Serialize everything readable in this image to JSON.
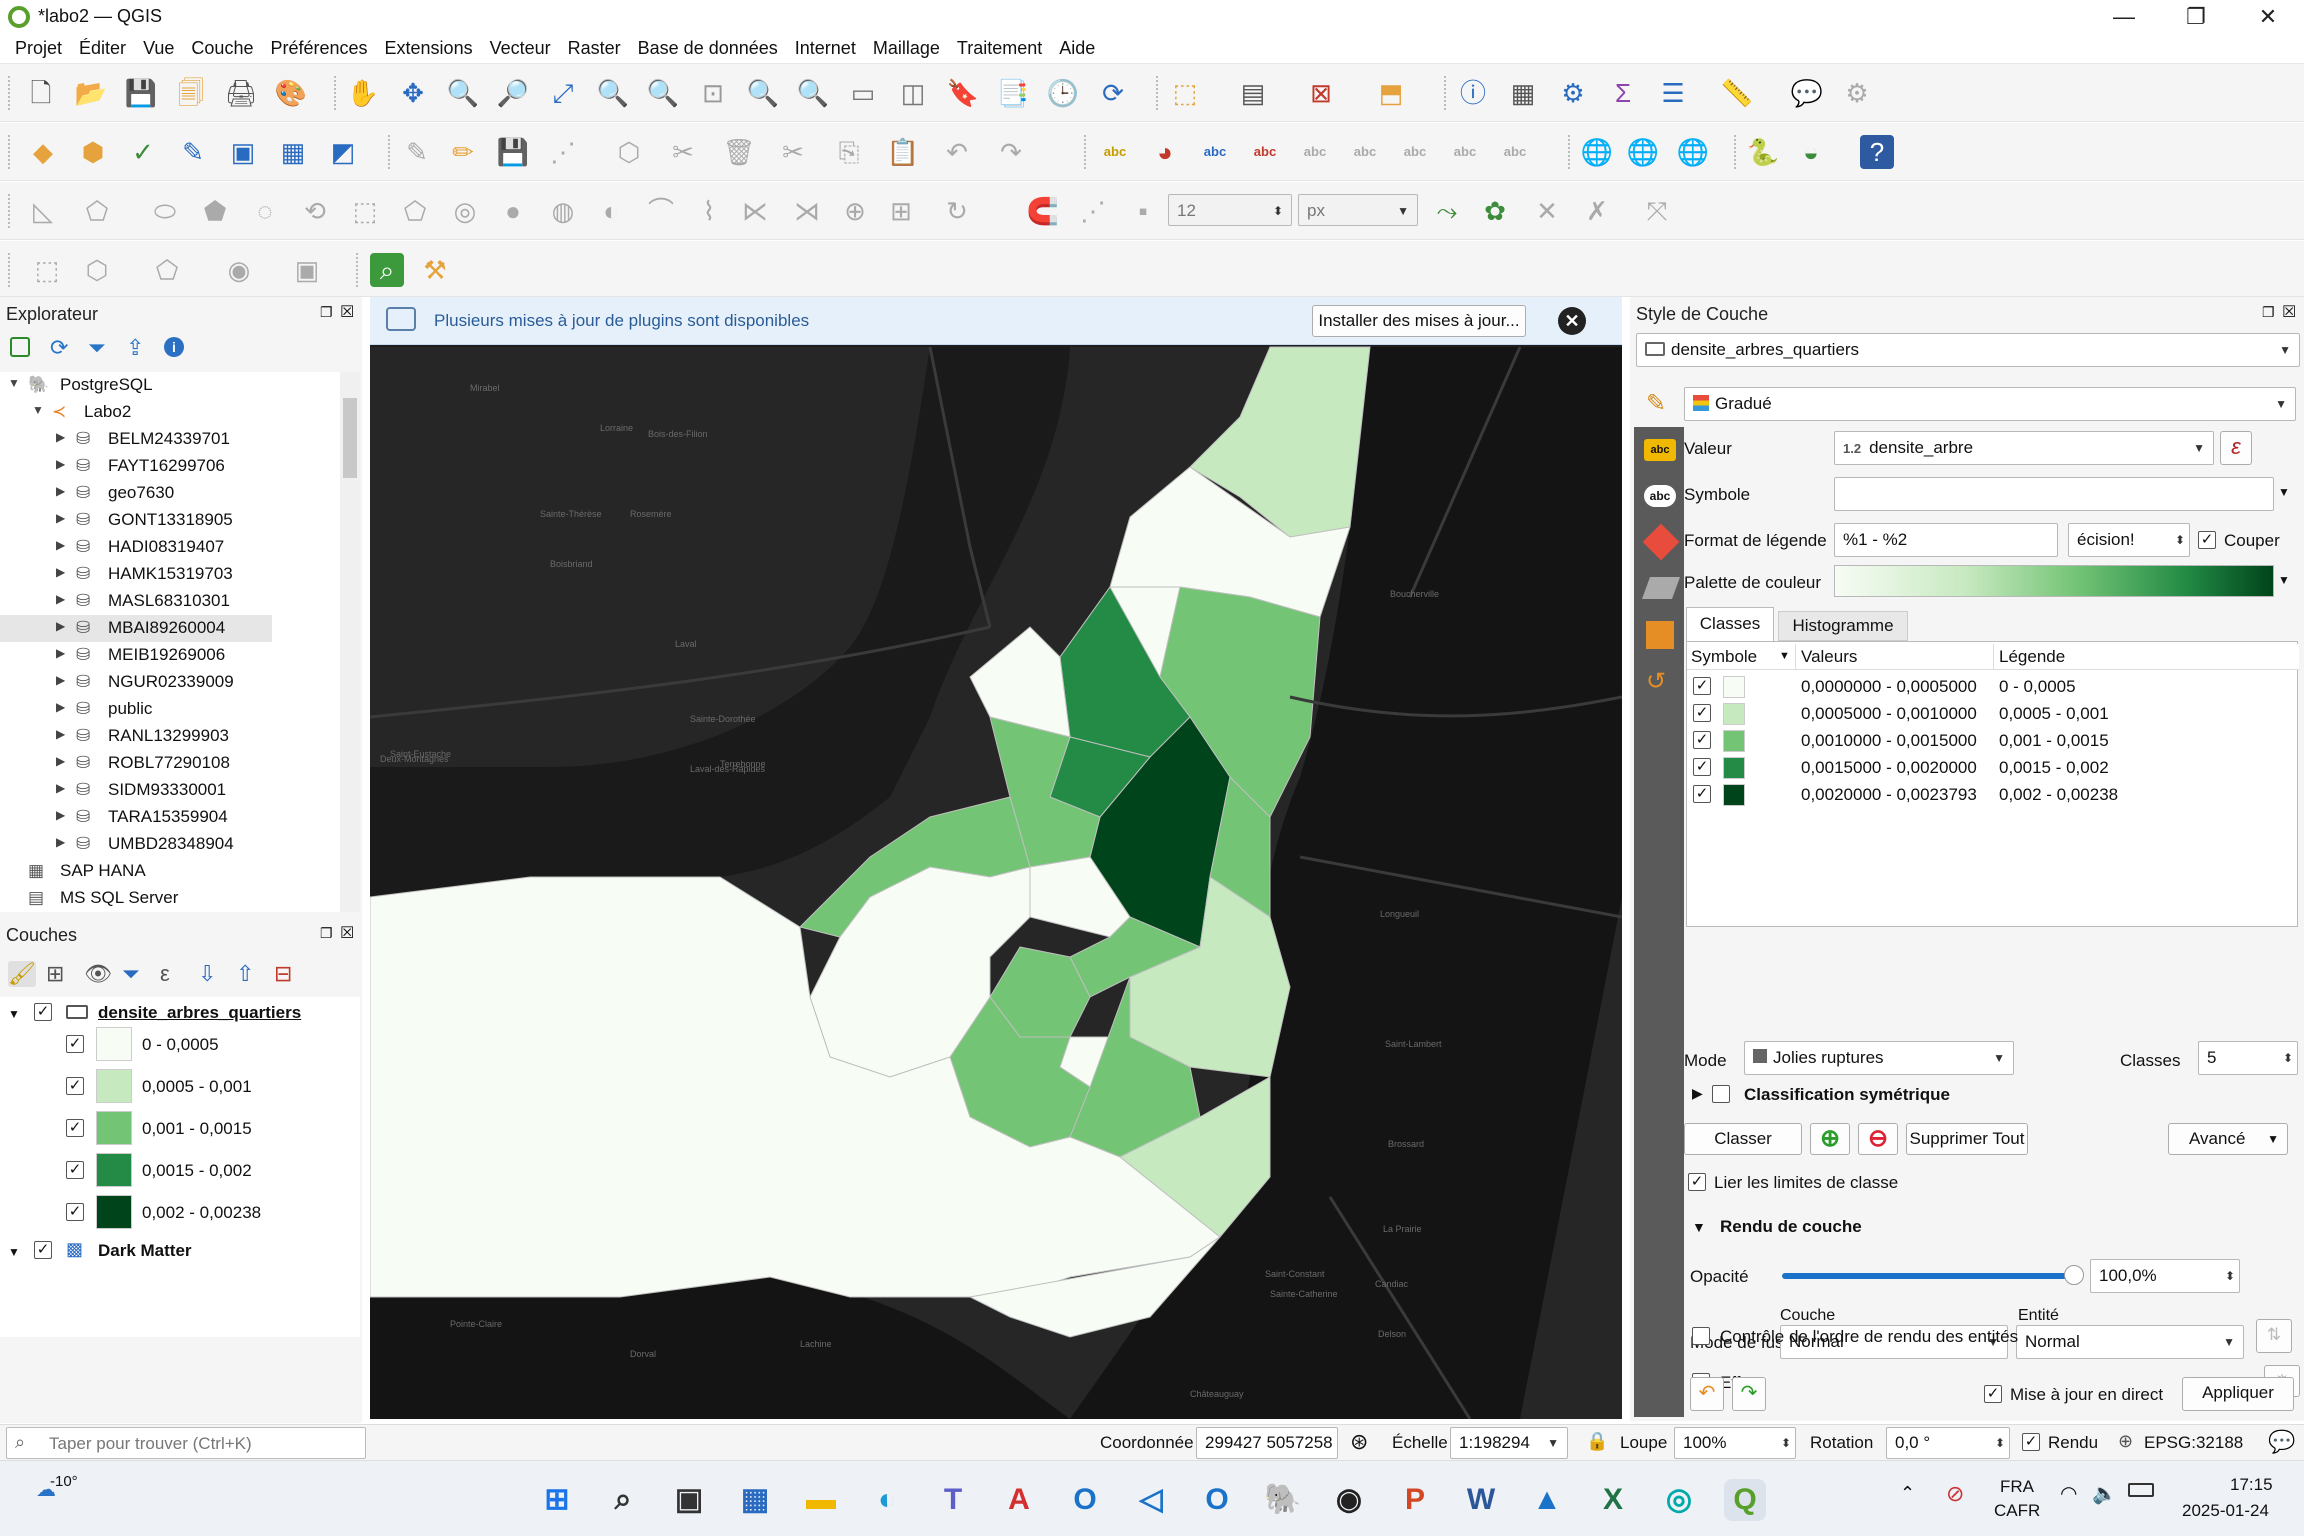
{
  "window": {
    "title": "*labo2 — QGIS",
    "min": "—",
    "max": "❐",
    "close": "✕"
  },
  "menu": [
    "Projet",
    "Éditer",
    "Vue",
    "Couche",
    "Préférences",
    "Extensions",
    "Vecteur",
    "Raster",
    "Base de données",
    "Internet",
    "Maillage",
    "Traitement",
    "Aide"
  ],
  "digitize": {
    "size": "12",
    "unit": "px"
  },
  "explorer": {
    "title": "Explorateur",
    "root": "PostgreSQL",
    "db": "Labo2",
    "schemas": [
      "BELM24339701",
      "FAYT16299706",
      "geo7630",
      "GONT13318905",
      "HADI08319407",
      "HAMK15319703",
      "MASL68310301",
      "MBAI89260004",
      "MEIB19269006",
      "NGUR02339009",
      "public",
      "RANL13299903",
      "ROBL77290108",
      "SIDM93330001",
      "TARA15359904",
      "UMBD28348904"
    ],
    "other": [
      "SAP HANA",
      "MS SQL Server"
    ]
  },
  "layers": {
    "title": "Couches",
    "layer": "densite_arbres_quartiers",
    "classes": [
      {
        "label": "0 - 0,0005",
        "color": "#f7fcf5"
      },
      {
        "label": "0,0005 - 0,001",
        "color": "#c7e9c0"
      },
      {
        "label": "0,001 - 0,0015",
        "color": "#74c476"
      },
      {
        "label": "0,0015 - 0,002",
        "color": "#238b45"
      },
      {
        "label": "0,002 - 0,00238",
        "color": "#00441b"
      }
    ],
    "basemap": "Dark Matter"
  },
  "notice": {
    "text": "Plusieurs mises à jour de plugins sont disponibles",
    "button": "Installer des mises à jour..."
  },
  "style": {
    "title": "Style de Couche",
    "layer": "densite_arbres_quartiers",
    "renderer": "Gradué",
    "valeur_label": "Valeur",
    "valeur": "densite_arbre",
    "valeur_prefix": "1.2",
    "symbole_label": "Symbole",
    "format_label": "Format de légende",
    "format": "%1 - %2",
    "precision": "écision!",
    "couper": "Couper",
    "palette_label": "Palette de couleur",
    "tabs": [
      "Classes",
      "Histogramme"
    ],
    "cols": [
      "Symbole",
      "Valeurs",
      "Légende"
    ],
    "rows": [
      {
        "v": "0,0000000 - 0,0005000",
        "l": "0 - 0,0005",
        "c": "#f7fcf5"
      },
      {
        "v": "0,0005000 - 0,0010000",
        "l": "0,0005 - 0,001",
        "c": "#c7e9c0"
      },
      {
        "v": "0,0010000 - 0,0015000",
        "l": "0,001 - 0,0015",
        "c": "#74c476"
      },
      {
        "v": "0,0015000 - 0,0020000",
        "l": "0,0015 - 0,002",
        "c": "#238b45"
      },
      {
        "v": "0,0020000 - 0,0023793",
        "l": "0,002 - 0,00238",
        "c": "#00441b"
      }
    ],
    "mode_label": "Mode",
    "mode": "Jolies ruptures",
    "classes_label": "Classes",
    "classes": "5",
    "sym": "Classification symétrique",
    "classer": "Classer",
    "supprimer": "Supprimer Tout",
    "avance": "Avancé",
    "lier": "Lier les limites de classe",
    "rendu": "Rendu de couche",
    "opacite_label": "Opacité",
    "opacite": "100,0%",
    "fusion_label": "Mode de fusion",
    "couche_label": "Couche",
    "entite_label": "Entité",
    "couche": "Normal",
    "entite": "Normal",
    "effets": "Effets",
    "ordre": "Contrôle de l'ordre de rendu des entités",
    "live": "Mise à jour en direct",
    "appliquer": "Appliquer"
  },
  "status": {
    "search": "Taper pour trouver (Ctrl+K)",
    "coord_label": "Coordonnée",
    "coord": "299427  5057258",
    "echelle_label": "Échelle",
    "echelle": "1:198294",
    "loupe_label": "Loupe",
    "loupe": "100%",
    "rotation_label": "Rotation",
    "rotation": "0,0 °",
    "rendu": "Rendu",
    "epsg": "EPSG:32188"
  },
  "map_labels": [
    "Mirabel",
    "Lorraine",
    "Bois-des-Filion",
    "Sainte-Thérèse",
    "Rosemère",
    "Boisbriand",
    "Laval",
    "Sainte-Dorothée",
    "Deux-Montagnes",
    "Terrebonne",
    "Boucherville",
    "Longueuil",
    "Saint-Lambert",
    "Brossard",
    "La Prairie",
    "Candiac",
    "Delson",
    "Saint-Constant",
    "Sainte-Catherine",
    "Châteauguay",
    "Lachine",
    "Dorval",
    "Pointe-Claire",
    "Laval-des-Rapides",
    "Saint-Eustache"
  ],
  "taskbar": {
    "weather": "-10°",
    "lang1": "FRA",
    "lang2": "CAFR",
    "time": "17:15",
    "date": "2025-01-24"
  }
}
